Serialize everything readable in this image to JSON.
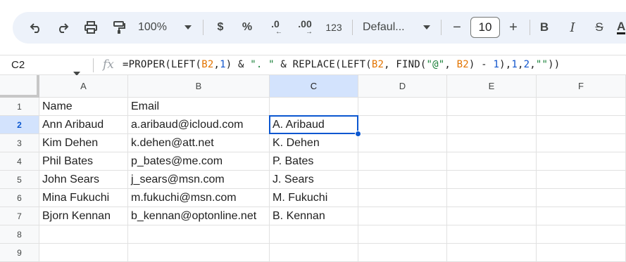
{
  "toolbar": {
    "zoom": "100%",
    "currency": "$",
    "percent": "%",
    "decrease_decimal": ".0",
    "increase_decimal": ".00",
    "number_format": "123",
    "font_family": "Defaul...",
    "font_size": "10",
    "decrease_font": "−",
    "increase_font": "+",
    "bold": "B",
    "italic": "I",
    "strikethrough": "S",
    "text_color": "A"
  },
  "formula_bar": {
    "name_box": "C2",
    "fx": "fx",
    "formula": {
      "p1": "=PROPER(LEFT(",
      "r1": "B2",
      "p2": ",",
      "n1": "1",
      "p3": ") & ",
      "s1": "\". \"",
      "p4": " & REPLACE(LEFT(",
      "r2": "B2",
      "p5": ", FIND(",
      "s2": "\"@\"",
      "p6": ", ",
      "r3": "B2",
      "p7": ") - ",
      "n2": "1",
      "p8": "),",
      "n3": "1",
      "p9": ",",
      "n4": "2",
      "p10": ",",
      "s3": "\"\"",
      "p11": "))"
    }
  },
  "columns": [
    "A",
    "B",
    "C",
    "D",
    "E",
    "F"
  ],
  "rows": [
    "1",
    "2",
    "3",
    "4",
    "5",
    "6",
    "7",
    "8",
    "9"
  ],
  "cells": {
    "A1": "Name",
    "B1": "Email",
    "C1": "",
    "A2": "Ann Aribaud",
    "B2": "a.aribaud@icloud.com",
    "C2": "A. Aribaud",
    "A3": "Kim Dehen",
    "B3": "k.dehen@att.net",
    "C3": "K. Dehen",
    "A4": "Phil Bates",
    "B4": "p_bates@me.com",
    "C4": "P. Bates",
    "A5": "John Sears",
    "B5": "j_sears@msn.com",
    "C5": "J. Sears",
    "A6": "Mina Fukuchi",
    "B6": "m.fukuchi@msn.com",
    "C6": "M. Fukuchi",
    "A7": "Bjorn Kennan",
    "B7": "b_kennan@optonline.net",
    "C7": "B. Kennan"
  },
  "selection": "C2",
  "colors": {
    "accent": "#0b57d0",
    "toolbar_bg": "#edf2fa",
    "header_bg": "#f8f9fa",
    "selected_header_bg": "#d3e3fd"
  }
}
